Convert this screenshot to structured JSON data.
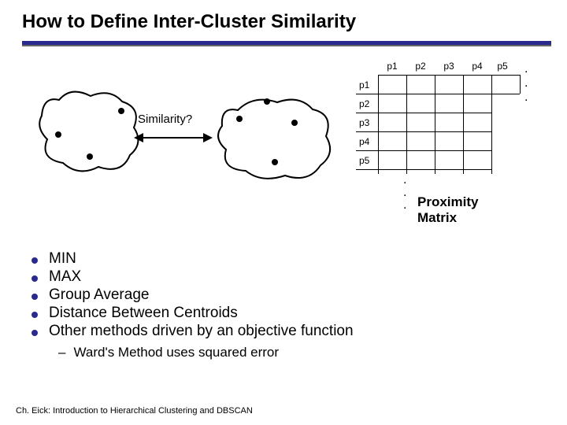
{
  "title": "How to Define Inter-Cluster Similarity",
  "similarity_label": "Similarity?",
  "matrix": {
    "cols": [
      "p1",
      "p2",
      "p3",
      "p4",
      "p5"
    ],
    "rows": [
      "p1",
      "p2",
      "p3",
      "p4",
      "p5"
    ],
    "caption": "Proximity Matrix",
    "hdots": ". . .",
    "vdot": "."
  },
  "list": {
    "items": [
      "MIN",
      "MAX",
      "Group Average",
      "Distance Between Centroids",
      "Other methods driven by an objective function"
    ],
    "sub": "Ward's Method uses squared error"
  },
  "footer": "Ch. Eick: Introduction to Hierarchical Clustering and DBSCAN"
}
